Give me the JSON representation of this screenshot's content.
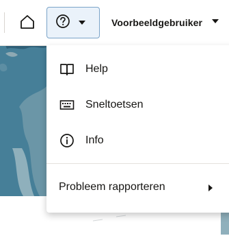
{
  "header": {
    "home_icon": "home-icon",
    "help_icon": "help-circle-icon",
    "help_chevron": "chevron-down-icon",
    "user_label": "Voorbeeldgebruiker",
    "user_chevron": "chevron-down-icon"
  },
  "menu": {
    "items": [
      {
        "label": "Help",
        "icon": "book-icon"
      },
      {
        "label": "Sneltoetsen",
        "icon": "keyboard-icon"
      },
      {
        "label": "Info",
        "icon": "info-icon"
      }
    ],
    "report": {
      "label": "Probleem rapporteren",
      "icon": "chevron-right-icon"
    }
  },
  "colors": {
    "accent_border": "#7aa3c8",
    "accent_bg": "#eaf2fa",
    "map_water": "#3d7a94",
    "map_land": "#bfc9cc"
  }
}
